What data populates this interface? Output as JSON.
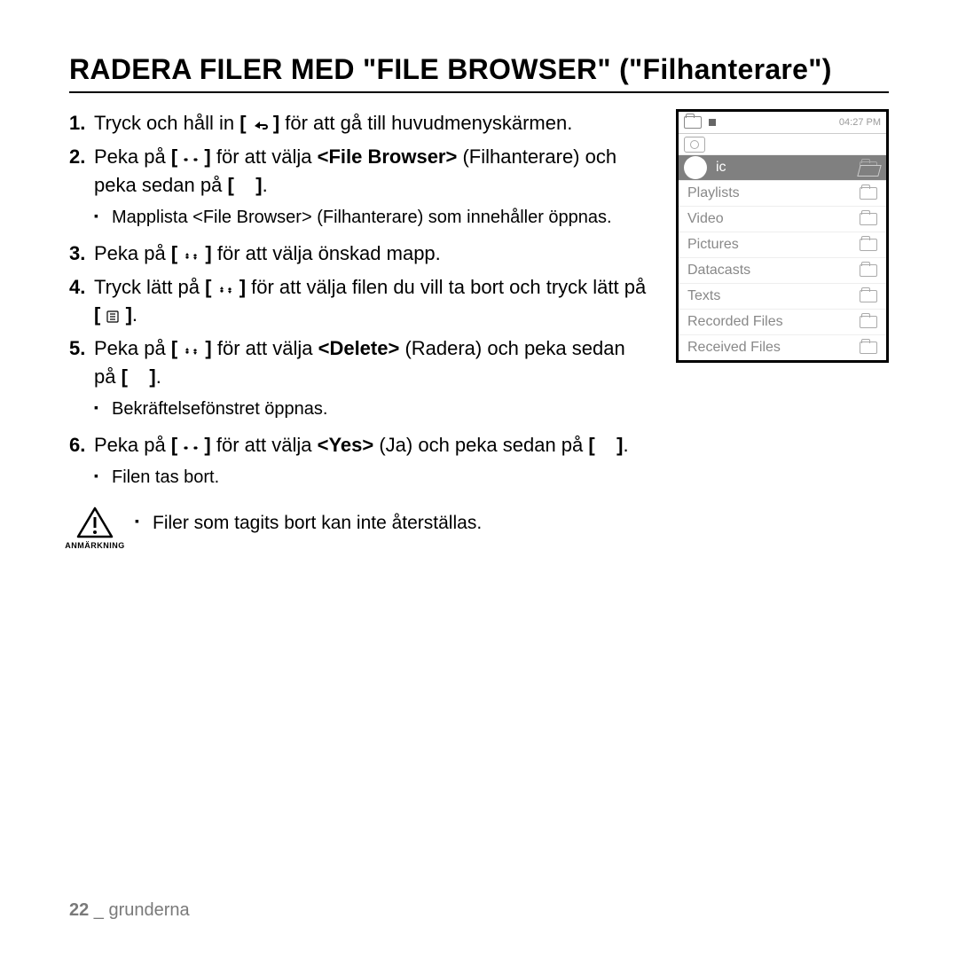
{
  "title": "RADERA FILER MED \"FILE BROWSER\" (\"Filhanterare\")",
  "steps": {
    "s1_a": "Tryck och håll in ",
    "s1_b": " för att gå till huvudmenyskärmen.",
    "s2_a": "Peka på ",
    "s2_b": " för att välja ",
    "s2_bold": "<File Browser>",
    "s2_c": " (Filhanterare) och peka sedan på ",
    "s2_d": ".",
    "s2_sub": "Mapplista <File Browser> (Filhanterare) som innehåller öppnas.",
    "s3_a": "Peka på ",
    "s3_b": " för att välja önskad mapp.",
    "s4_a": "Tryck lätt på ",
    "s4_b": " för att välja filen du vill ta bort och tryck lätt på ",
    "s4_c": ".",
    "s5_a": "Peka på ",
    "s5_b": " för att välja ",
    "s5_bold": "<Delete>",
    "s5_c": " (Radera) och peka sedan på ",
    "s5_d": ".",
    "s5_sub": "Bekräftelsefönstret öppnas.",
    "s6_a": " Peka på ",
    "s6_b": " för att välja ",
    "s6_bold": "<Yes>",
    "s6_c": " (Ja) och peka sedan på ",
    "s6_d": ".",
    "s6_sub": "Filen tas bort."
  },
  "note": {
    "label": "ANMÄRKNING",
    "text": "Filer som tagits bort kan inte återställas."
  },
  "screen": {
    "time": "04:27 PM",
    "selected_suffix": "ic",
    "rows": [
      "Playlists",
      "Video",
      "Pictures",
      "Datacasts",
      "Texts",
      "Recorded Files",
      "Received Files"
    ]
  },
  "footer": {
    "page": "22",
    "sep": " _ ",
    "section": "grunderna"
  },
  "nums": {
    "n1": "1.",
    "n2": "2.",
    "n3": "3.",
    "n4": "4.",
    "n5": "5.",
    "n6": "6."
  },
  "brackets": {
    "open": "[",
    "close": "]"
  }
}
